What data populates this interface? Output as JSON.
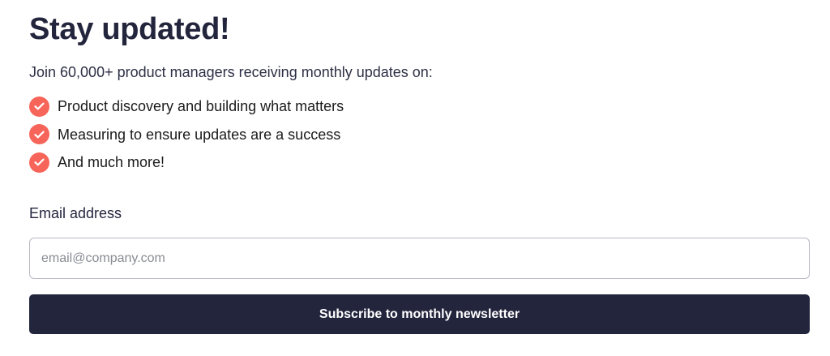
{
  "heading": "Stay updated!",
  "subtitle": "Join 60,000+ product managers receiving monthly updates on:",
  "features": [
    {
      "text": "Product discovery and building what matters",
      "icon": "check-circle-icon"
    },
    {
      "text": "Measuring to ensure updates are a success",
      "icon": "check-circle-icon"
    },
    {
      "text": "And much more!",
      "icon": "check-circle-icon"
    }
  ],
  "form": {
    "email_label": "Email address",
    "email_value": "",
    "email_placeholder": "email@company.com",
    "submit_label": "Subscribe to monthly newsletter"
  },
  "colors": {
    "primary": "#23253d",
    "accent": "#f76459",
    "background": "#ffffff"
  }
}
